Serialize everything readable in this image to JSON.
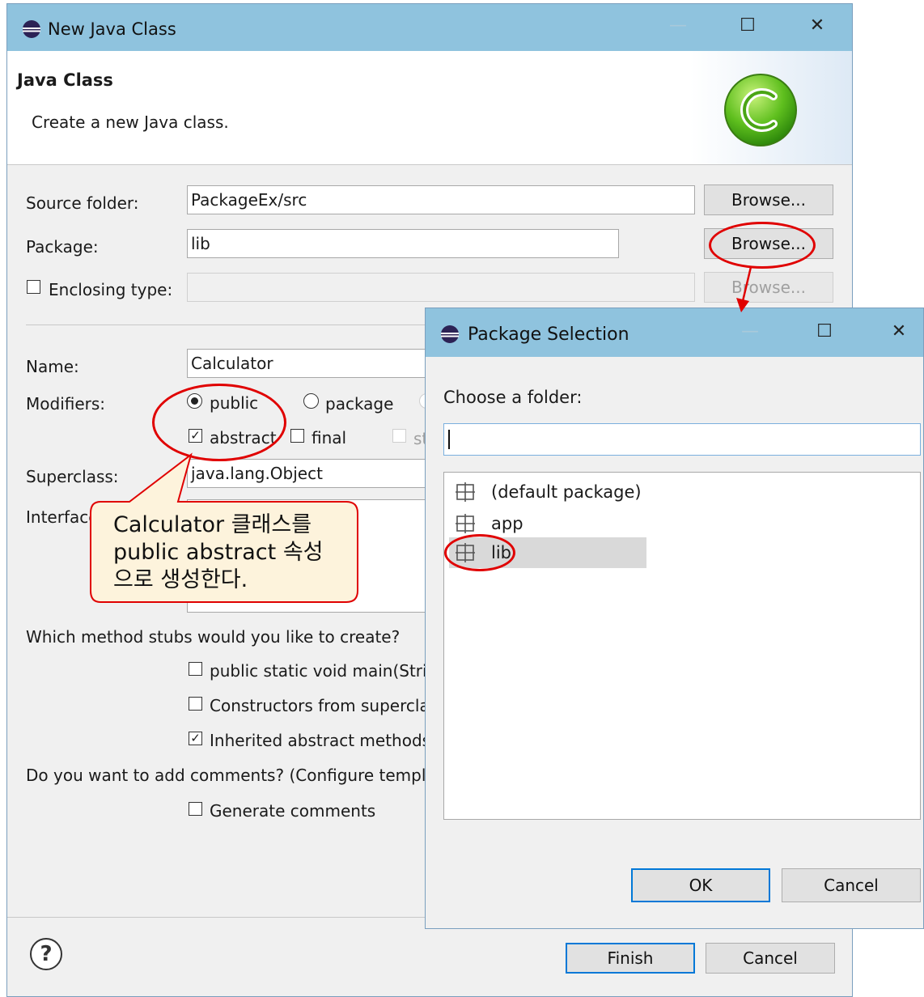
{
  "main_dialog": {
    "title": "New Java Class",
    "header_title": "Java Class",
    "header_subtitle": "Create a new Java class.",
    "source_folder": {
      "label": "Source folder:",
      "value": "PackageEx/src",
      "browse": "Browse..."
    },
    "package": {
      "label": "Package:",
      "value": "lib",
      "browse": "Browse..."
    },
    "enclosing_type": {
      "label": "Enclosing type:",
      "value": "",
      "browse": "Browse..."
    },
    "name": {
      "label": "Name:",
      "value": "Calculator"
    },
    "modifiers": {
      "label": "Modifiers:",
      "public": "public",
      "package": "package",
      "abstract": "abstract",
      "final": "final",
      "static_partial": "st"
    },
    "superclass": {
      "label": "Superclass:",
      "value": "java.lang.Object"
    },
    "interfaces_label": "Interfaces:",
    "stubs_question": "Which method stubs would you like to create?",
    "stub_main": "public static void main(String[] args)",
    "stub_constructors": "Constructors from superclass",
    "stub_inherited": "Inherited abstract methods",
    "comments_question": "Do you want to add comments? (Configure templates and default value here)",
    "generate_comments": "Generate comments",
    "help_glyph": "?",
    "finish": "Finish",
    "cancel": "Cancel"
  },
  "package_dialog": {
    "title": "Package Selection",
    "prompt": "Choose a folder:",
    "filter_value": "",
    "items": [
      "(default package)",
      "app",
      "lib"
    ],
    "selected": "lib",
    "ok": "OK",
    "cancel": "Cancel"
  },
  "callout": {
    "line1": "Calculator 클래스를",
    "line2": "public abstract 속성",
    "line3": "으로 생성한다."
  },
  "colors": {
    "titlebar": "#8fc3de",
    "annotation_red": "#e00000",
    "callout_fill": "#fdf3dc"
  }
}
